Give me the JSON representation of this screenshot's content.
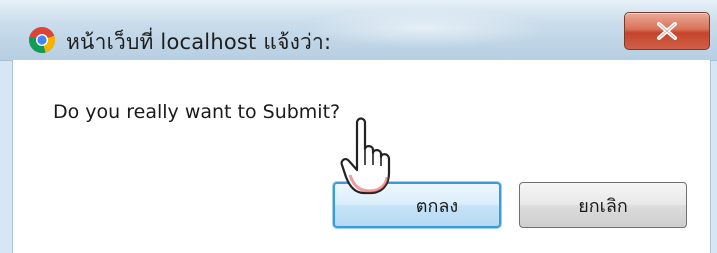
{
  "dialog": {
    "title": "หน้าเว็บที่ localhost แจ้งว่า:",
    "message": "Do you really want to Submit?",
    "close_icon": "close-icon",
    "app_icon": "chrome-icon"
  },
  "buttons": {
    "ok_label": "ตกลง",
    "cancel_label": "ยกเลิก"
  },
  "cursor": {
    "type": "hand-pointer-icon"
  },
  "colors": {
    "close_button": "#c4442a",
    "ok_focus_border": "#3c9ad9",
    "titlebar": "#c9dceb"
  }
}
